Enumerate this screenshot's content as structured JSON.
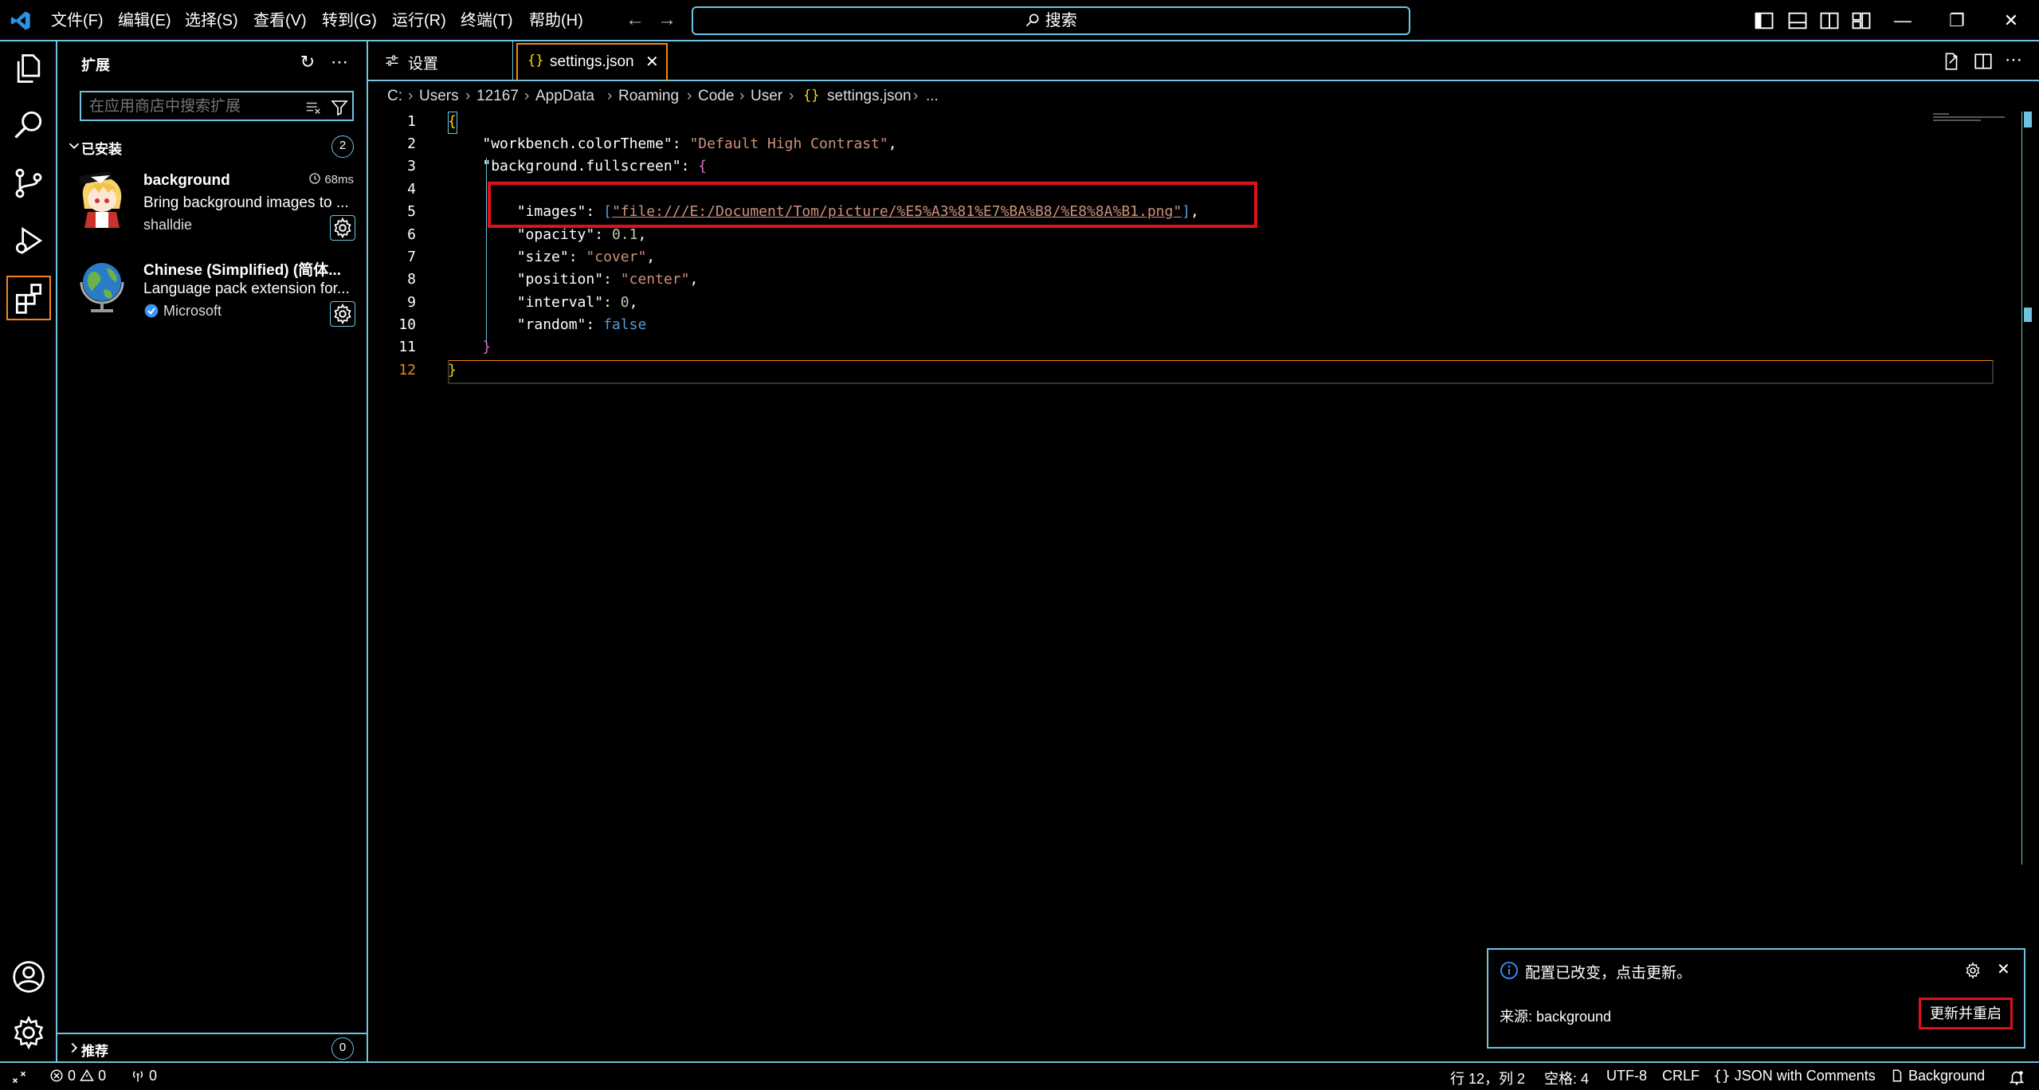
{
  "titlebar": {
    "menu": [
      "文件(F)",
      "编辑(E)",
      "选择(S)",
      "查看(V)",
      "转到(G)",
      "运行(R)",
      "终端(T)",
      "帮助(H)"
    ],
    "search_label": "搜索"
  },
  "sidebar": {
    "title": "扩展",
    "search_placeholder": "在应用商店中搜索扩展",
    "installed_label": "已安装",
    "installed_count": "2",
    "recommended_label": "推荐",
    "recommended_count": "0",
    "extensions": [
      {
        "name": "background",
        "description": "Bring background images to ...",
        "publisher": "shalldie",
        "meta": "68ms"
      },
      {
        "name": "Chinese (Simplified) (简体...",
        "description": "Language pack extension for...",
        "publisher": "Microsoft",
        "meta": ""
      }
    ]
  },
  "tabs": [
    {
      "label": "设置"
    },
    {
      "label": "settings.json"
    }
  ],
  "breadcrumb": [
    "C:",
    "Users",
    "12167",
    "AppData",
    "Roaming",
    "Code",
    "User",
    "settings.json",
    "..."
  ],
  "editor": {
    "line_numbers": [
      "1",
      "2",
      "3",
      "4",
      "5",
      "6",
      "7",
      "8",
      "9",
      "10",
      "11",
      "12"
    ],
    "lines": {
      "l1": "{",
      "l2_key": "\"workbench.colorTheme\"",
      "l2_val": "\"Default High Contrast\"",
      "l3_key": "\"background.fullscreen\"",
      "l3_brace": "{",
      "l5_key": "\"images\"",
      "l5_val": "\"file:///E:/Document/Tom/picture/%E5%A3%81%E7%BA%B8/%E8%8A%B1.png\"",
      "l6_key": "\"opacity\"",
      "l6_val": "0.1",
      "l7_key": "\"size\"",
      "l7_val": "\"cover\"",
      "l8_key": "\"position\"",
      "l8_val": "\"center\"",
      "l9_key": "\"interval\"",
      "l9_val": "0",
      "l10_key": "\"random\"",
      "l10_val": "false",
      "l11": "}",
      "l12": "}"
    }
  },
  "notification": {
    "message": "配置已改变，点击更新。",
    "source": "来源: background",
    "button": "更新并重启"
  },
  "statusbar": {
    "errors": "0",
    "warnings": "0",
    "ports": "0",
    "position": "行 12，列 2",
    "spaces": "空格: 4",
    "encoding": "UTF-8",
    "eol": "CRLF",
    "language": "JSON with Comments",
    "background": "Background"
  }
}
